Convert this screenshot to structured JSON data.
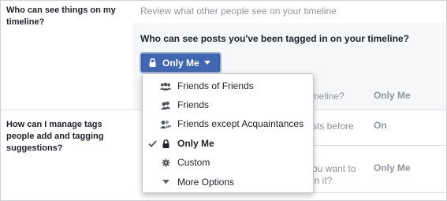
{
  "sections": [
    {
      "label": "Who can see things on my timeline?",
      "description": "Review what other people see on your timeline",
      "panel_question": "Who can see posts you've been tagged in on your timeline?",
      "rows": [
        {
          "partial_text": "imeline?",
          "value": "Only Me"
        }
      ]
    },
    {
      "label": "How can I manage tags people add and tagging suggestions?",
      "rows": [
        {
          "partial_text": "sts before",
          "value": "On"
        },
        {
          "partial_text_line1": "ou want to",
          "partial_text_line2": "in it?",
          "value": "Only Me"
        }
      ]
    }
  ],
  "audience_button": {
    "label": "Only Me",
    "icon": "lock-icon",
    "caret": "chevron-down-icon"
  },
  "dropdown": {
    "items": [
      {
        "label": "Friends of Friends",
        "icon": "friends-of-friends-icon",
        "selected": false
      },
      {
        "label": "Friends",
        "icon": "friends-icon",
        "selected": false
      },
      {
        "label": "Friends except Acquaintances",
        "icon": "friends-except-acquaintances-icon",
        "selected": false
      },
      {
        "label": "Only Me",
        "icon": "lock-icon",
        "selected": true
      },
      {
        "label": "Custom",
        "icon": "gear-icon",
        "selected": false
      },
      {
        "label": "More Options",
        "icon": "triangle-down-icon",
        "selected": false
      }
    ]
  },
  "colors": {
    "button_blue": "#4267b2",
    "muted_text": "#90949c",
    "panel_bg": "#f6f7f9",
    "border": "#cfd2d7"
  }
}
